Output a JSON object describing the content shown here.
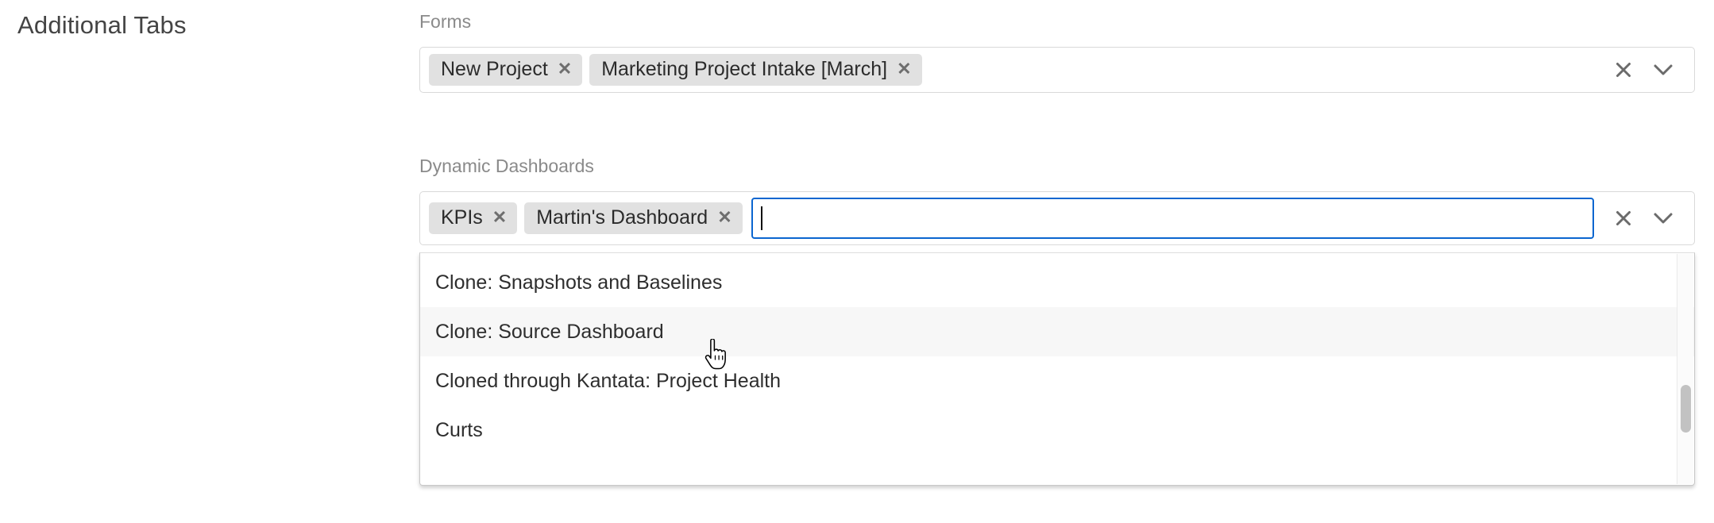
{
  "section": {
    "heading": "Additional Tabs"
  },
  "fields": [
    {
      "label": "Forms",
      "tags": [
        {
          "text": "New Project",
          "remove": "✕"
        },
        {
          "text": "Marketing Project Intake [March]",
          "remove": "✕"
        }
      ],
      "focused": false,
      "clear_icon": "clear-icon",
      "toggle_icon": "chevron-down-icon"
    },
    {
      "label": "Dynamic Dashboards",
      "tags": [
        {
          "text": "KPIs",
          "remove": "✕"
        },
        {
          "text": "Martin's Dashboard",
          "remove": "✕"
        }
      ],
      "focused": true,
      "input_value": "",
      "clear_icon": "clear-icon",
      "toggle_icon": "chevron-down-icon"
    }
  ],
  "dropdown": {
    "open_for": "Dynamic Dashboards",
    "active_index": 1,
    "options": [
      "Clone: Snapshots and Baselines",
      "Clone: Source Dashboard",
      "Cloned through Kantata: Project Health",
      "Curts"
    ],
    "scrollbar": {
      "visible": true,
      "thumb_position_pct": 57
    }
  },
  "colors": {
    "focus_border": "#0b66d0",
    "tag_background": "#e1e1e1",
    "option_hover": "#f7f7f7",
    "label_text": "#8a8a8a",
    "heading_text": "#444444"
  },
  "cursor": {
    "type": "pointer-hand",
    "over": "Clone: Source Dashboard"
  }
}
